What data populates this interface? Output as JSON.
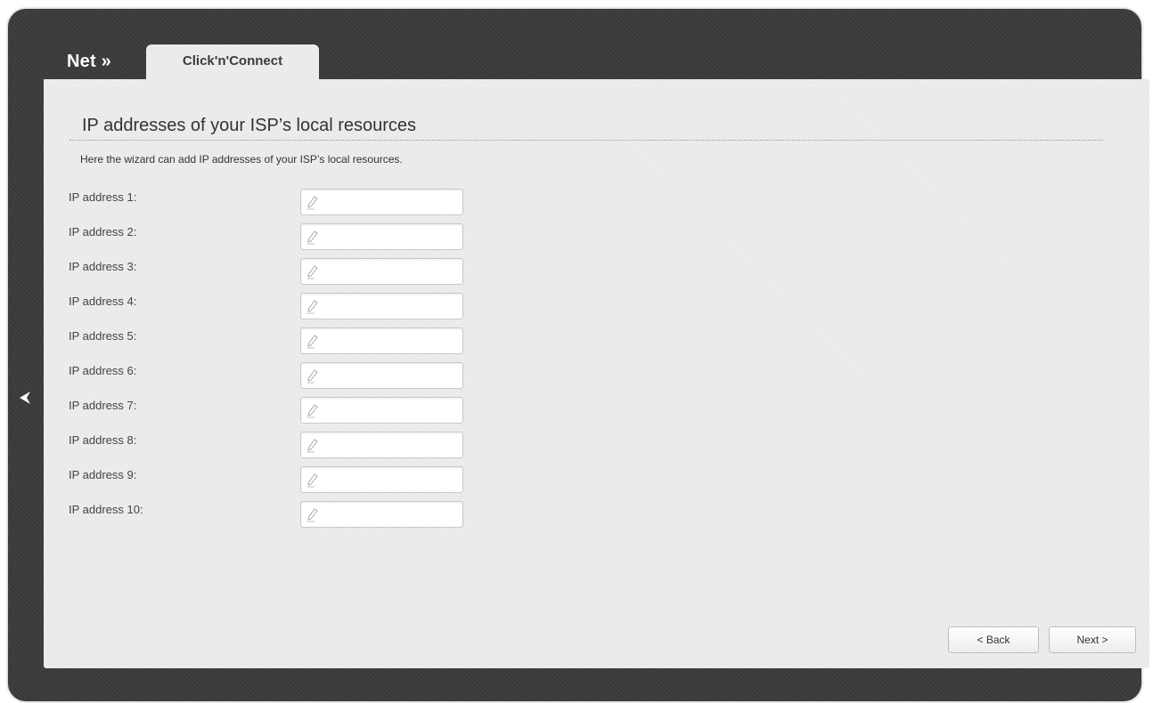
{
  "header": {
    "breadcrumb_root": "Net »",
    "active_tab": "Click'n'Connect"
  },
  "page": {
    "title": "IP addresses of your ISP’s local resources",
    "description": "Here the wizard can add IP addresses of your ISP’s local resources."
  },
  "fields": [
    {
      "label": "IP address 1:",
      "value": ""
    },
    {
      "label": "IP address 2:",
      "value": ""
    },
    {
      "label": "IP address 3:",
      "value": ""
    },
    {
      "label": "IP address 4:",
      "value": ""
    },
    {
      "label": "IP address 5:",
      "value": ""
    },
    {
      "label": "IP address 6:",
      "value": ""
    },
    {
      "label": "IP address 7:",
      "value": ""
    },
    {
      "label": "IP address 8:",
      "value": ""
    },
    {
      "label": "IP address 9:",
      "value": ""
    },
    {
      "label": "IP address 10:",
      "value": ""
    }
  ],
  "field_icon": "pencil-icon",
  "navigation": {
    "back_arrow_icon": "chevron-left-icon",
    "back_label": "< Back",
    "next_label": "Next >"
  },
  "colors": {
    "frame": "#3b3b3b",
    "panel": "#ececec",
    "tab": "#ebebeb"
  }
}
